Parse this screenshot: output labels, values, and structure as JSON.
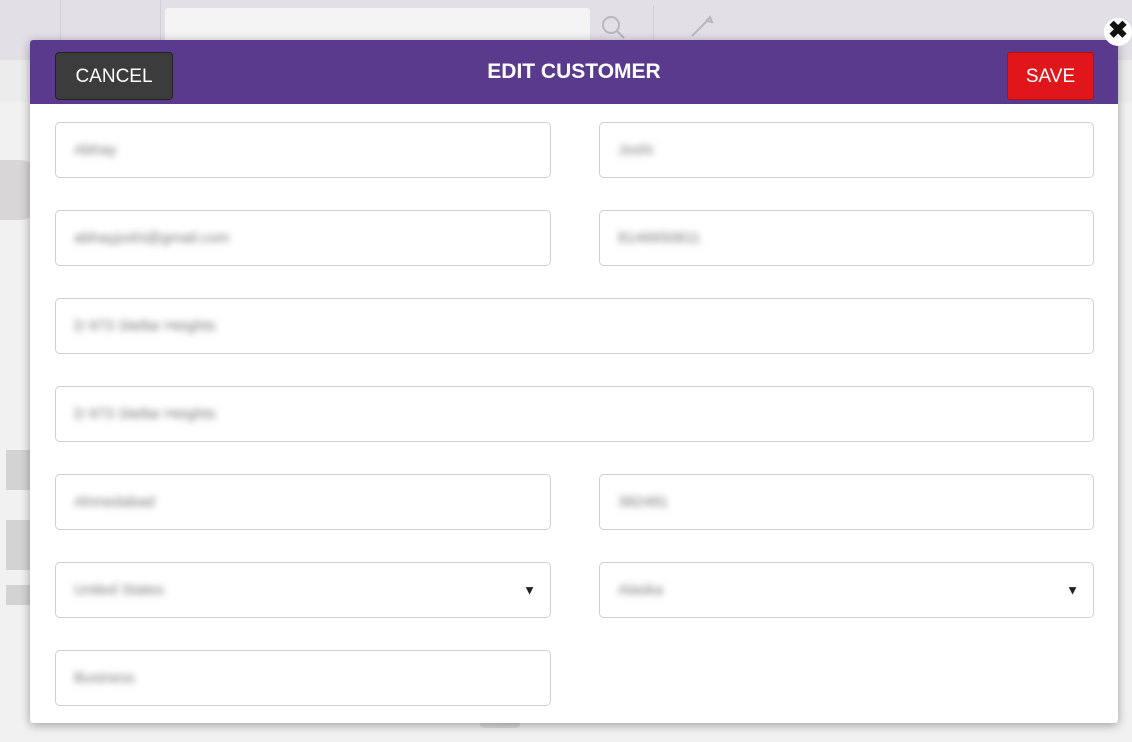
{
  "modal": {
    "title": "EDIT CUSTOMER",
    "cancel_label": "CANCEL",
    "save_label": "SAVE",
    "close_symbol": "✖",
    "fields": {
      "first_name": "Abhay",
      "last_name": "Joshi",
      "email": "abhayjoshi@gmail.com",
      "phone": "8146650811",
      "address_1": "D 973 Stellar Heights",
      "address_2": "D 973 Stellar Heights",
      "city": "Ahmedabad",
      "zip": "382481",
      "country": "United States",
      "state": "Alaska",
      "company": "Business"
    },
    "dropdown_symbol": "▼"
  },
  "colors": {
    "header": "#5a3a8c",
    "save": "#e0161b",
    "cancel": "#3c3c3c"
  },
  "icons": {
    "background_search": "search-icon",
    "background_tool": "wrench-icon",
    "close": "close-icon"
  }
}
